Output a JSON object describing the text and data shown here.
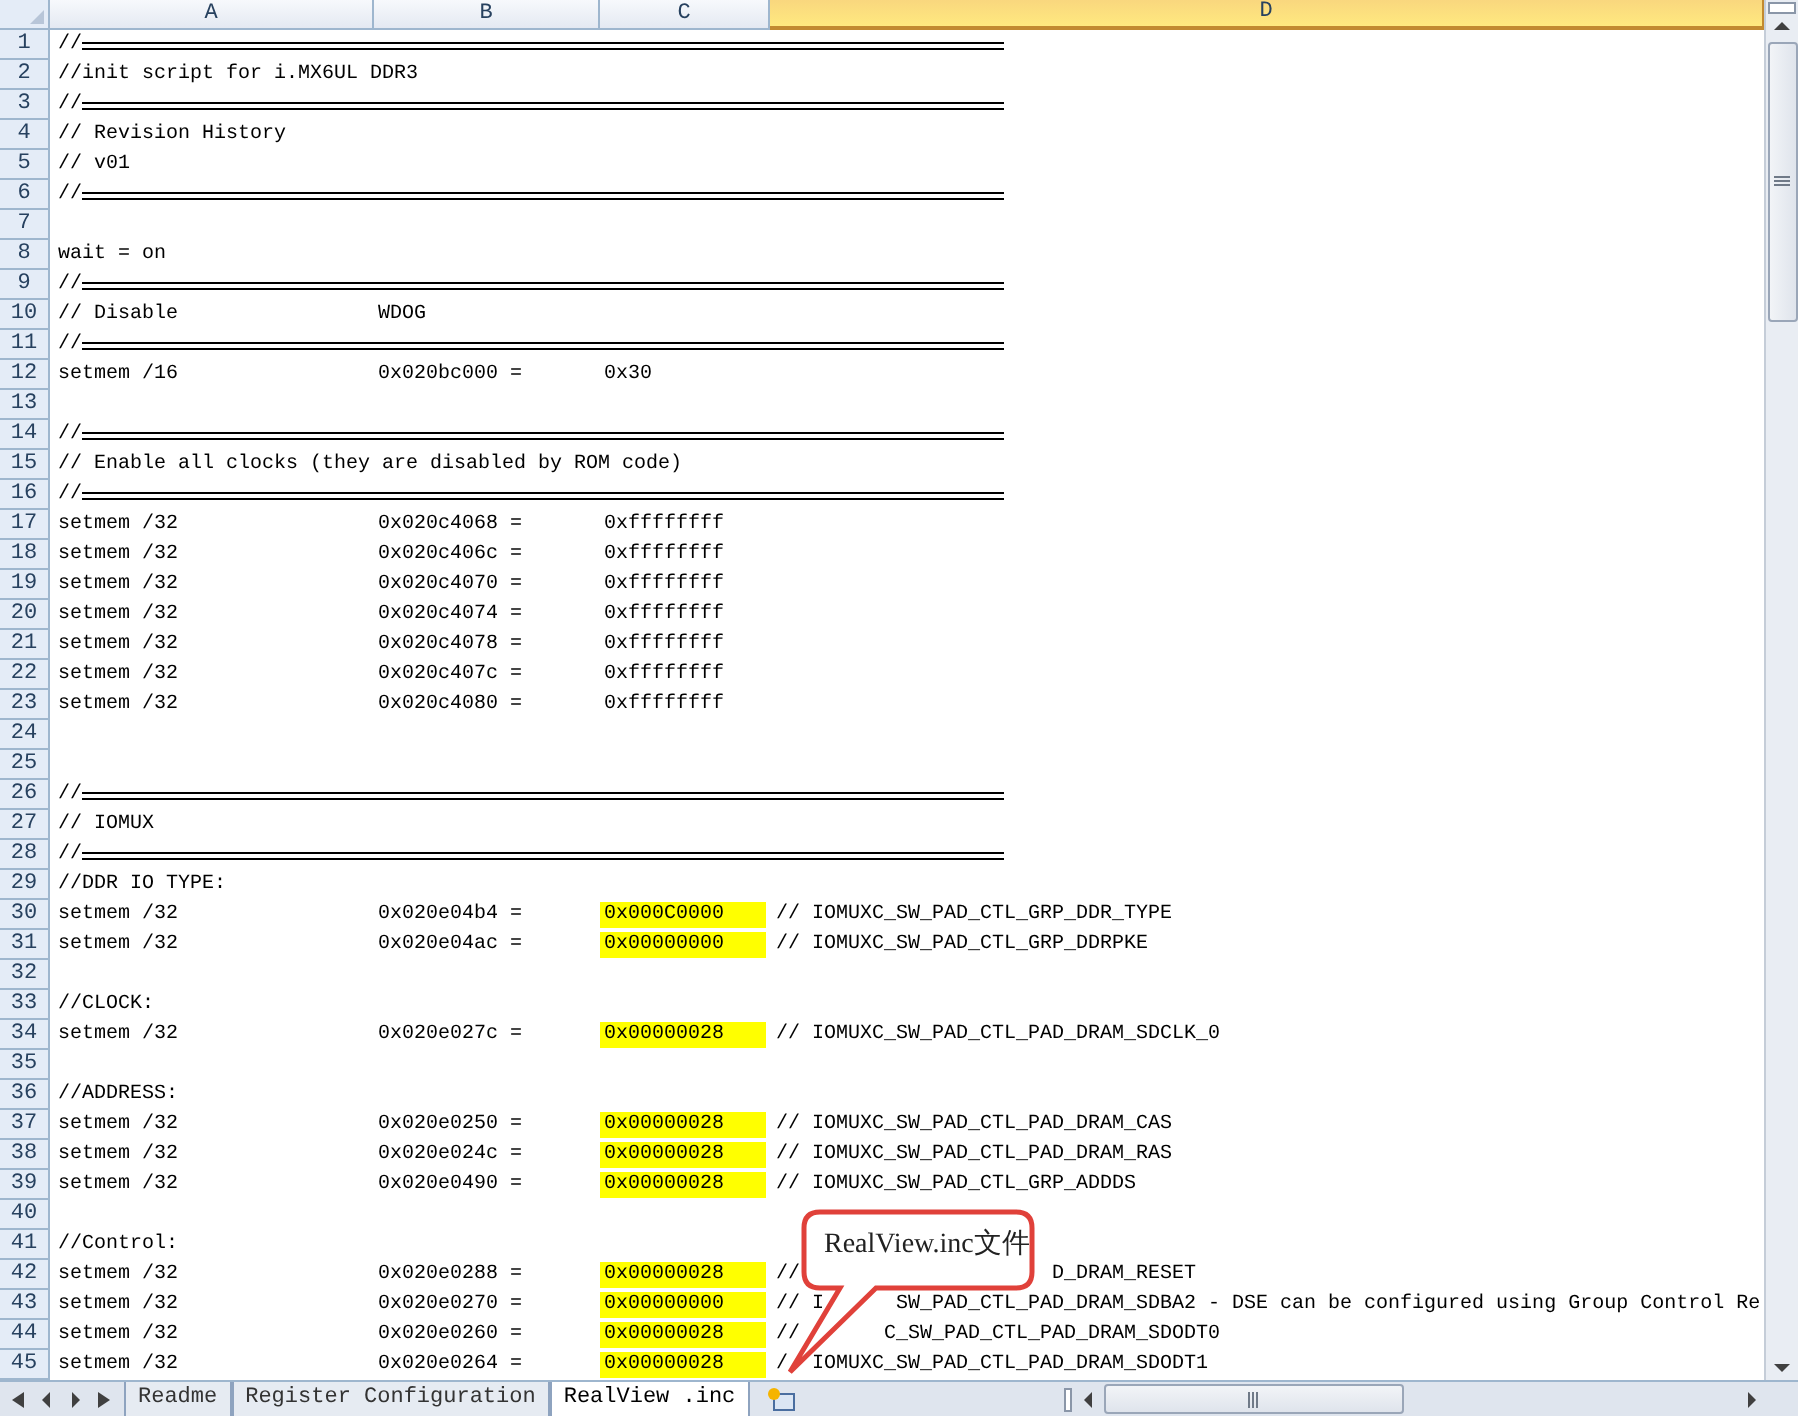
{
  "columns": [
    {
      "label": "A",
      "selected": false
    },
    {
      "label": "B",
      "selected": false
    },
    {
      "label": "C",
      "selected": false
    },
    {
      "label": "D",
      "selected": true
    }
  ],
  "rows": [
    {
      "number": "1",
      "kind": "rule",
      "a": "//"
    },
    {
      "number": "2",
      "kind": "cells",
      "a": "//init script for i.MX6UL DDR3"
    },
    {
      "number": "3",
      "kind": "rule",
      "a": "//"
    },
    {
      "number": "4",
      "kind": "cells",
      "a": "// Revision History"
    },
    {
      "number": "5",
      "kind": "cells",
      "a": "// v01"
    },
    {
      "number": "6",
      "kind": "rule",
      "a": "//"
    },
    {
      "number": "7",
      "kind": "empty"
    },
    {
      "number": "8",
      "kind": "cells",
      "a": "wait = on"
    },
    {
      "number": "9",
      "kind": "rule",
      "a": "//"
    },
    {
      "number": "10",
      "kind": "cells",
      "a": "// Disable",
      "b": "WDOG"
    },
    {
      "number": "11",
      "kind": "rule",
      "a": "//"
    },
    {
      "number": "12",
      "kind": "cells",
      "a": "setmem /16",
      "b": "0x020bc000 =",
      "c": "0x30",
      "highlighted": false
    },
    {
      "number": "13",
      "kind": "empty"
    },
    {
      "number": "14",
      "kind": "rule",
      "a": "//"
    },
    {
      "number": "15",
      "kind": "cells",
      "a": "// Enable all clocks (they are disabled by ROM code)"
    },
    {
      "number": "16",
      "kind": "rule",
      "a": "//"
    },
    {
      "number": "17",
      "kind": "cells",
      "a": "setmem /32",
      "b": "0x020c4068 =",
      "c": "0xffffffff",
      "highlighted": false
    },
    {
      "number": "18",
      "kind": "cells",
      "a": "setmem /32",
      "b": "0x020c406c =",
      "c": "0xffffffff",
      "highlighted": false
    },
    {
      "number": "19",
      "kind": "cells",
      "a": "setmem /32",
      "b": "0x020c4070 =",
      "c": "0xffffffff",
      "highlighted": false
    },
    {
      "number": "20",
      "kind": "cells",
      "a": "setmem /32",
      "b": "0x020c4074 =",
      "c": "0xffffffff",
      "highlighted": false
    },
    {
      "number": "21",
      "kind": "cells",
      "a": "setmem /32",
      "b": "0x020c4078 =",
      "c": "0xffffffff",
      "highlighted": false
    },
    {
      "number": "22",
      "kind": "cells",
      "a": "setmem /32",
      "b": "0x020c407c =",
      "c": "0xffffffff",
      "highlighted": false
    },
    {
      "number": "23",
      "kind": "cells",
      "a": "setmem /32",
      "b": "0x020c4080 =",
      "c": "0xffffffff",
      "highlighted": false
    },
    {
      "number": "24",
      "kind": "empty"
    },
    {
      "number": "25",
      "kind": "empty"
    },
    {
      "number": "26",
      "kind": "rule",
      "a": "//"
    },
    {
      "number": "27",
      "kind": "cells",
      "a": "// IOMUX"
    },
    {
      "number": "28",
      "kind": "rule",
      "a": "//"
    },
    {
      "number": "29",
      "kind": "cells",
      "a": "//DDR IO TYPE:"
    },
    {
      "number": "30",
      "kind": "cells",
      "a": "setmem /32",
      "b": "0x020e04b4 =",
      "c": "0x000C0000",
      "highlighted": true,
      "d": "// IOMUXC_SW_PAD_CTL_GRP_DDR_TYPE"
    },
    {
      "number": "31",
      "kind": "cells",
      "a": "setmem /32",
      "b": "0x020e04ac =",
      "c": "0x00000000",
      "highlighted": true,
      "d": "// IOMUXC_SW_PAD_CTL_GRP_DDRPKE"
    },
    {
      "number": "32",
      "kind": "empty"
    },
    {
      "number": "33",
      "kind": "cells",
      "a": "//CLOCK:"
    },
    {
      "number": "34",
      "kind": "cells",
      "a": "setmem /32",
      "b": "0x020e027c =",
      "c": "0x00000028",
      "highlighted": true,
      "d": "// IOMUXC_SW_PAD_CTL_PAD_DRAM_SDCLK_0"
    },
    {
      "number": "35",
      "kind": "empty"
    },
    {
      "number": "36",
      "kind": "cells",
      "a": "//ADDRESS:"
    },
    {
      "number": "37",
      "kind": "cells",
      "a": "setmem /32",
      "b": "0x020e0250 =",
      "c": "0x00000028",
      "highlighted": true,
      "d": "// IOMUXC_SW_PAD_CTL_PAD_DRAM_CAS"
    },
    {
      "number": "38",
      "kind": "cells",
      "a": "setmem /32",
      "b": "0x020e024c =",
      "c": "0x00000028",
      "highlighted": true,
      "d": "// IOMUXC_SW_PAD_CTL_PAD_DRAM_RAS"
    },
    {
      "number": "39",
      "kind": "cells",
      "a": "setmem /32",
      "b": "0x020e0490 =",
      "c": "0x00000028",
      "highlighted": true,
      "d": "// IOMUXC_SW_PAD_CTL_GRP_ADDDS"
    },
    {
      "number": "40",
      "kind": "empty"
    },
    {
      "number": "41",
      "kind": "cells",
      "a": "//Control:"
    },
    {
      "number": "42",
      "kind": "cells",
      "a": "setmem /32",
      "b": "0x020e0288 =",
      "c": "0x00000028",
      "highlighted": true,
      "d": "//                     D_DRAM_RESET"
    },
    {
      "number": "43",
      "kind": "cells",
      "a": "setmem /32",
      "b": "0x020e0270 =",
      "c": "0x00000000",
      "highlighted": true,
      "d": "// I      SW_PAD_CTL_PAD_DRAM_SDBA2 - DSE can be configured using Group Control Re"
    },
    {
      "number": "44",
      "kind": "cells",
      "a": "setmem /32",
      "b": "0x020e0260 =",
      "c": "0x00000028",
      "highlighted": true,
      "d": "//       C_SW_PAD_CTL_PAD_DRAM_SDODT0"
    },
    {
      "number": "45",
      "kind": "cells",
      "a": "setmem /32",
      "b": "0x020e0264 =",
      "c": "0x00000028",
      "highlighted": true,
      "d": "/  IOMUXC_SW_PAD_CTL_PAD_DRAM_SDODT1"
    }
  ],
  "sheet_tabs": [
    {
      "label": "Readme",
      "selected": false
    },
    {
      "label": "Register Configuration",
      "selected": false
    },
    {
      "label": "RealView .inc",
      "selected": true
    }
  ],
  "callout": {
    "text": "RealView.inc文件"
  }
}
